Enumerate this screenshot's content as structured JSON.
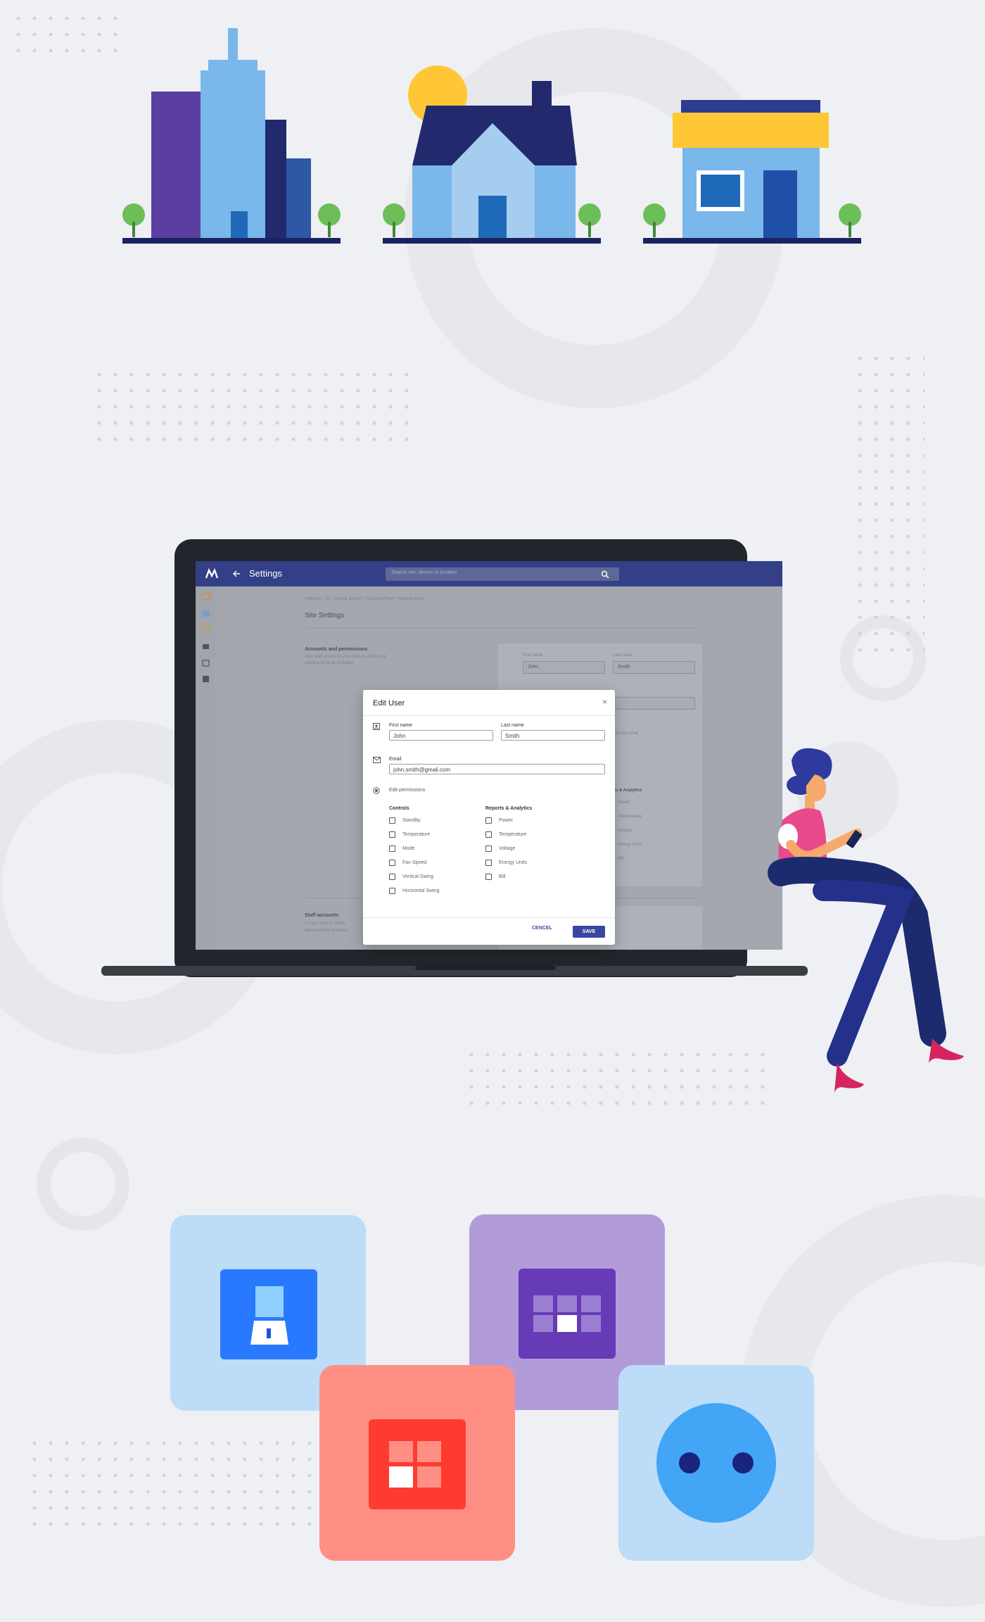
{
  "app": {
    "title": "Settings",
    "search_placeholder": "Search site, device or location",
    "breadcrumb": "Settings / SC Central Branch / Ground Floor / Waiting Area",
    "page_title": "Site Settings",
    "accounts": {
      "heading": "Accounts and permissions",
      "description_line1": "Give staff access to your sites or devices by",
      "description_line2": "sending them an invitation."
    },
    "background_form": {
      "first_name_label": "First name",
      "first_name_value": "John",
      "last_name_label": "Last name",
      "last_name_value": "Smith",
      "invite_text": "ent by email",
      "reports_heading": "eports & Analytics",
      "reports_items": [
        "Power",
        "Temperature",
        "Voltage",
        "Energy Units",
        "Bill"
      ]
    },
    "staff": {
      "heading": "Staff accounts",
      "description_line1": "Do you want to delete",
      "description_line2": "device will be removed"
    }
  },
  "modal": {
    "title": "Edit User",
    "close_symbol": "×",
    "first_name_label": "First name",
    "first_name_value": "John",
    "last_name_label": "Last name",
    "last_name_value": "Smith",
    "email_label": "Email",
    "email_value": "john.smith@gmail.com",
    "permissions_label": "Edit permissions",
    "controls_heading": "Controls",
    "controls": [
      "Standby",
      "Temperature",
      "Mode",
      "Fan Speed",
      "Vertical Swing",
      "Horizontal Swing"
    ],
    "reports_heading": "Reports & Analytics",
    "reports": [
      "Power",
      "Temperature",
      "Voltage",
      "Energy Units",
      "Bill"
    ],
    "cancel_label": "CENCEL",
    "save_label": "SAVE"
  },
  "colors": {
    "background": "#eef0f4",
    "topbar": "#333f87",
    "accent": "#3b46a3",
    "tile_blue": "#bddcf8",
    "tile_purple": "#b19cd9",
    "tile_red": "#ff8f85"
  },
  "icons": [
    "office-building-icon",
    "house-icon",
    "shop-icon",
    "light-switch-icon",
    "multi-switch-icon",
    "wall-switch-icon",
    "power-socket-icon",
    "back-arrow-icon",
    "search-icon",
    "close-icon",
    "user-icon",
    "mail-icon",
    "permissions-icon"
  ]
}
